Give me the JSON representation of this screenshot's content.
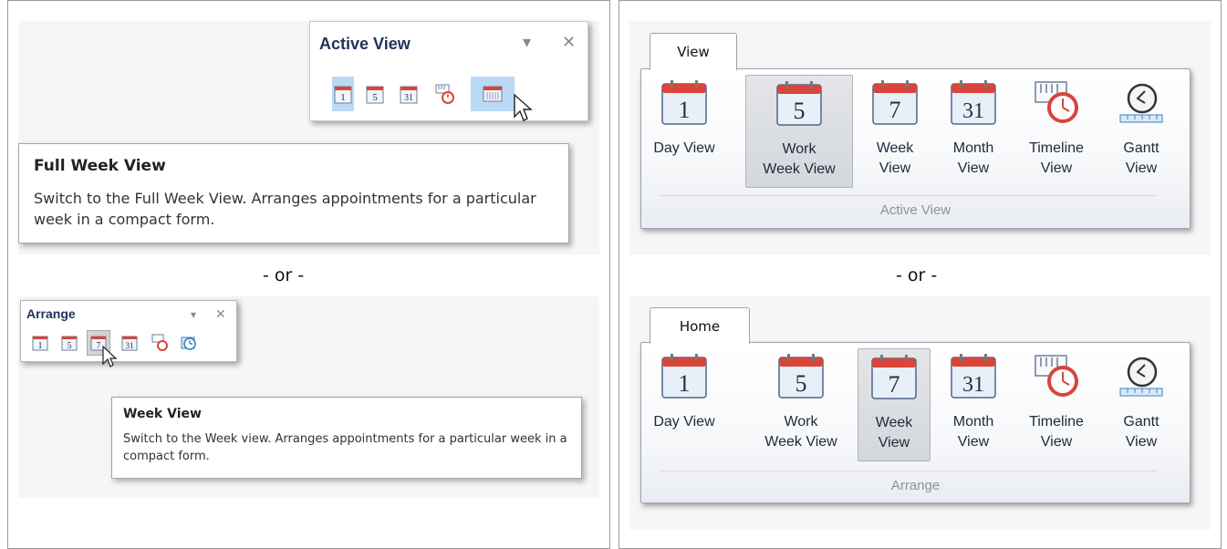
{
  "separator": "- or -",
  "top_left": {
    "toolbar": {
      "title": "Active View",
      "dropdown_glyph": "▾",
      "close_glyph": "✕",
      "buttons": [
        {
          "name": "day-view-button",
          "num": "1"
        },
        {
          "name": "work-week-view-button",
          "num": "5"
        },
        {
          "name": "month-view-button",
          "num": "31"
        },
        {
          "name": "timeline-view-button",
          "num": ""
        },
        {
          "name": "full-week-view-button",
          "num": ""
        }
      ]
    },
    "tooltip": {
      "title": "Full Week View",
      "body": "Switch to the Full Week View. Arranges appointments for a particular week in a compact form."
    }
  },
  "bottom_left": {
    "toolbar": {
      "title": "Arrange",
      "dropdown_glyph": "▾",
      "close_glyph": "✕",
      "buttons": [
        {
          "name": "day-view-button",
          "num": "1"
        },
        {
          "name": "work-week-view-button",
          "num": "5"
        },
        {
          "name": "week-view-button",
          "num": "7"
        },
        {
          "name": "month-view-button",
          "num": "31"
        },
        {
          "name": "timeline-view-button",
          "num": ""
        },
        {
          "name": "gantt-view-button",
          "num": ""
        }
      ]
    },
    "tooltip": {
      "title": "Week View",
      "body": "Switch to the Week view. Arranges appointments for a particular week in a compact form."
    }
  },
  "ribbon_top": {
    "tab": "View",
    "group_label": "Active View",
    "buttons": [
      {
        "label": "Day View",
        "num": "1"
      },
      {
        "label": "Work\nWeek View",
        "num": "5"
      },
      {
        "label": "Week\nView",
        "num": "7"
      },
      {
        "label": "Month\nView",
        "num": "31"
      },
      {
        "label": "Timeline\nView",
        "num": ""
      },
      {
        "label": "Gantt\nView",
        "num": ""
      }
    ]
  },
  "ribbon_bottom": {
    "tab": "Home",
    "group_label": "Arrange",
    "buttons": [
      {
        "label": "Day View",
        "num": "1"
      },
      {
        "label": "Work\nWeek View",
        "num": "5"
      },
      {
        "label": "Week\nView",
        "num": "7"
      },
      {
        "label": "Month\nView",
        "num": "31"
      },
      {
        "label": "Timeline\nView",
        "num": ""
      },
      {
        "label": "Gantt\nView",
        "num": ""
      }
    ]
  },
  "colors": {
    "calendar_red": "#d9453b",
    "highlight": "#b9d9f4",
    "title_blue": "#20335b"
  }
}
